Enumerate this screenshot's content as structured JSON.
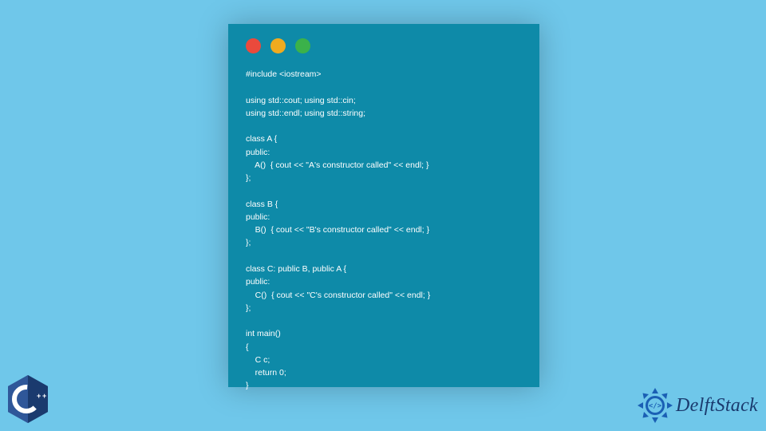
{
  "window": {
    "traffic": {
      "red": "close-dot",
      "yellow": "minimize-dot",
      "green": "maximize-dot"
    }
  },
  "code": {
    "text": "#include <iostream>\n\nusing std::cout; using std::cin;\nusing std::endl; using std::string;\n\nclass A {\npublic:\n    A()  { cout << \"A's constructor called\" << endl; }\n};\n\nclass B {\npublic:\n    B()  { cout << \"B's constructor called\" << endl; }\n};\n\nclass C: public B, public A {\npublic:\n    C()  { cout << \"C's constructor called\" << endl; }\n};\n\nint main()\n{\n    C c;\n    return 0;\n}"
  },
  "branding": {
    "cpp_label": "C++",
    "delftstack_text": "DelftStack"
  },
  "colors": {
    "page_bg": "#6fc7ea",
    "window_bg": "#0e8aa8",
    "code_fg": "#ffffff",
    "brand_fg": "#1a3a6e"
  }
}
